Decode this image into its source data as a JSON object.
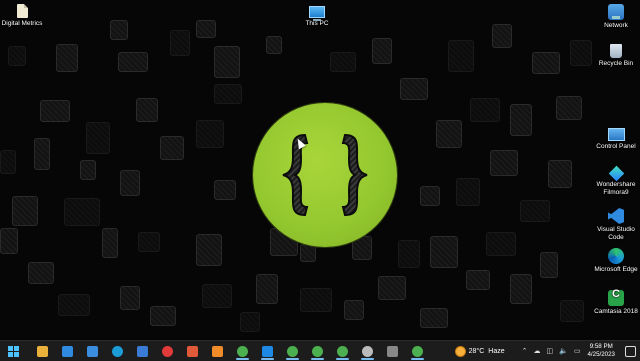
{
  "desktop": {
    "icons": [
      {
        "label": "Digital Metrics",
        "icon": "file-icon"
      },
      {
        "label": "This PC",
        "icon": "computer-icon"
      },
      {
        "label": "Network",
        "icon": "network-icon"
      },
      {
        "label": "Recycle Bin",
        "icon": "recycle-bin-icon"
      },
      {
        "label": "Control Panel",
        "icon": "control-panel-icon"
      },
      {
        "label": "Wondershare Filmora9",
        "icon": "filmora-icon"
      },
      {
        "label": "Visual Studio Code",
        "icon": "vscode-icon"
      },
      {
        "label": "Microsoft Edge",
        "icon": "edge-icon"
      },
      {
        "label": "Camtasia 2018",
        "icon": "camtasia-icon"
      }
    ],
    "wallpaper_logo": {
      "glyph": "{ }",
      "color": "#93c72e",
      "icon": "curly-braces-logo-icon"
    }
  },
  "taskbar": {
    "start_icon": "windows-logo-icon",
    "apps": [
      {
        "icon": "file-explorer-icon",
        "color": "#e9b13c",
        "active": false
      },
      {
        "icon": "calendar-icon",
        "color": "#2f8ae0",
        "active": false
      },
      {
        "icon": "mail-icon",
        "color": "#3b8de0",
        "active": false
      },
      {
        "icon": "edge-icon",
        "color": "#1c9dd8",
        "active": false
      },
      {
        "icon": "store-icon",
        "color": "#3a7bd5",
        "active": false
      },
      {
        "icon": "opera-icon",
        "color": "#e03a3a",
        "active": false
      },
      {
        "icon": "app-red-icon",
        "color": "#e05a3a",
        "active": false
      },
      {
        "icon": "xampp-icon",
        "color": "#f08c2a",
        "active": false
      },
      {
        "icon": "chrome-icon",
        "color": "#4caf50",
        "active": true
      },
      {
        "icon": "app-blue-icon",
        "color": "#1e88e5",
        "active": true
      },
      {
        "icon": "chrome-icon",
        "color": "#4caf50",
        "active": true
      },
      {
        "icon": "chrome-icon",
        "color": "#4caf50",
        "active": true
      },
      {
        "icon": "chrome-icon",
        "color": "#4caf50",
        "active": true
      },
      {
        "icon": "obs-icon",
        "color": "#bbbbbb",
        "active": true
      },
      {
        "icon": "app-icon",
        "color": "#888888",
        "active": false
      },
      {
        "icon": "chrome-icon",
        "color": "#4caf50",
        "active": true
      }
    ],
    "weather": {
      "temp": "28°C",
      "condition": "Haze",
      "icon": "sun-icon"
    },
    "tray_icons": [
      "chevron-up-icon",
      "cloud-icon",
      "network-icon",
      "speaker-icon",
      "battery-icon"
    ],
    "clock": {
      "time": "9:58 PM",
      "date": "4/25/2023"
    },
    "notification_icon": "notification-icon"
  }
}
